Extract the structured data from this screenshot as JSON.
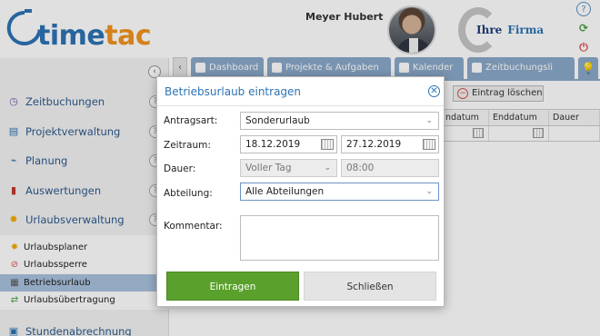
{
  "header": {
    "logo_main": "time",
    "logo_accent": "tac",
    "user_name": "Meyer Hubert",
    "company_first": "Ihre",
    "company_second": "Firma"
  },
  "sidebar": {
    "items": [
      {
        "label": "Zeitbuchungen",
        "icon": "clock-icon"
      },
      {
        "label": "Projektverwaltung",
        "icon": "clipboard-icon"
      },
      {
        "label": "Planung",
        "icon": "chart-line-icon"
      },
      {
        "label": "Auswertungen",
        "icon": "bar-chart-icon"
      },
      {
        "label": "Urlaubsverwaltung",
        "icon": "sun-icon"
      }
    ],
    "subitems": [
      {
        "label": "Urlaubsplaner",
        "icon": "sun-icon"
      },
      {
        "label": "Urlaubssperre",
        "icon": "sun-block-icon"
      },
      {
        "label": "Betriebsurlaub",
        "icon": "building-icon"
      },
      {
        "label": "Urlaubsübertragung",
        "icon": "transfer-icon"
      }
    ],
    "bottom_item": "Stundenabrechnung"
  },
  "tabs": [
    {
      "label": "Dashboard"
    },
    {
      "label": "Projekte & Aufgaben"
    },
    {
      "label": "Kalender"
    },
    {
      "label": "Zeitbuchungsli"
    }
  ],
  "toolbar": {
    "delete_label": "Eintrag löschen"
  },
  "grid": {
    "columns": [
      "ndatum",
      "Enddatum",
      "Dauer"
    ]
  },
  "dialog": {
    "title": "Betriebsurlaub eintragen",
    "antragsart_label": "Antragsart:",
    "antragsart_value": "Sonderurlaub",
    "zeitraum_label": "Zeitraum:",
    "date_from": "18.12.2019",
    "date_to": "27.12.2019",
    "dauer_label": "Dauer:",
    "dauer_value": "Voller Tag",
    "dauer_time": "08:00",
    "abteilung_label": "Abteilung:",
    "abteilung_value": "Alle Abteilungen",
    "kommentar_label": "Kommentar:",
    "submit_label": "Eintragen",
    "close_label": "Schließen"
  },
  "colors": {
    "brand_blue": "#2d74b4",
    "brand_orange": "#f29320",
    "submit_green": "#5aa02c",
    "tab_blue": "#8aa9c9"
  }
}
